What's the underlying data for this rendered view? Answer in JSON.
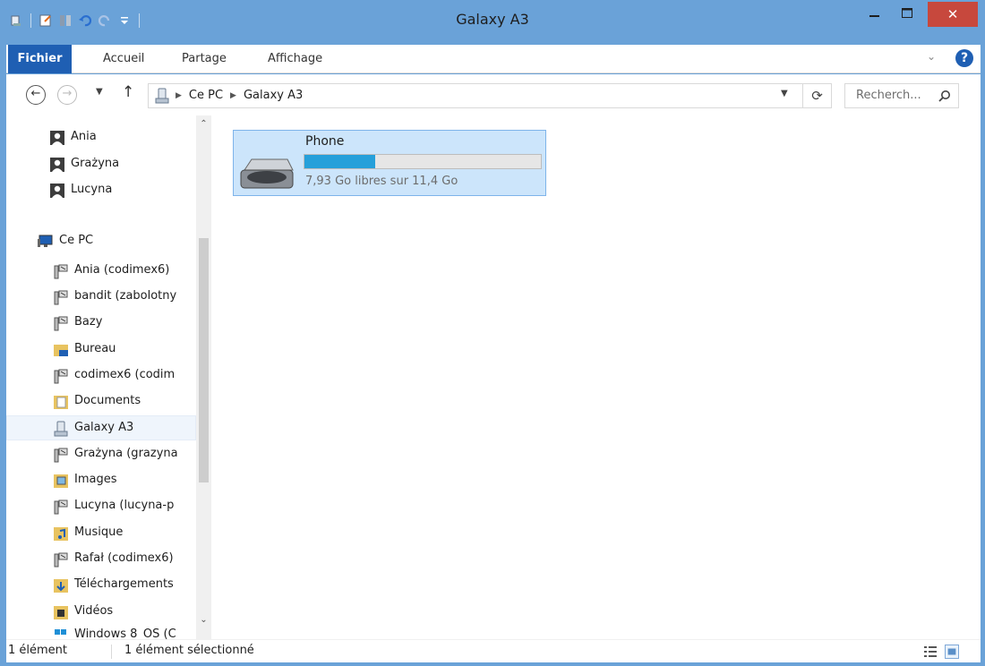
{
  "window": {
    "title": "Galaxy A3",
    "close_glyph": "✕"
  },
  "ribbon": {
    "tabs": {
      "file": "Fichier",
      "home": "Accueil",
      "share": "Partage",
      "view": "Affichage"
    },
    "help_glyph": "?"
  },
  "address": {
    "crumbs": [
      "Ce PC",
      "Galaxy A3"
    ],
    "search_placeholder": "Recherch..."
  },
  "nav": {
    "items": [
      {
        "label": "Ania",
        "icon": "user-folder-icon"
      },
      {
        "label": "Grażyna",
        "icon": "user-folder-icon"
      },
      {
        "label": "Lucyna",
        "icon": "user-folder-icon"
      },
      {
        "label": "Ce PC",
        "icon": "computer-icon"
      },
      {
        "label": "Ania (codimex6)",
        "icon": "network-drive-icon"
      },
      {
        "label": "bandit (zabolotny",
        "icon": "network-drive-icon"
      },
      {
        "label": "Bazy",
        "icon": "network-drive-icon"
      },
      {
        "label": "Bureau",
        "icon": "desktop-folder-icon"
      },
      {
        "label": "codimex6 (codim",
        "icon": "network-drive-icon"
      },
      {
        "label": "Documents",
        "icon": "documents-folder-icon"
      },
      {
        "label": "Galaxy A3",
        "icon": "phone-device-icon"
      },
      {
        "label": "Grażyna (grazyna",
        "icon": "network-drive-icon"
      },
      {
        "label": "Images",
        "icon": "pictures-folder-icon"
      },
      {
        "label": "Lucyna (lucyna-p",
        "icon": "network-drive-icon"
      },
      {
        "label": "Musique",
        "icon": "music-folder-icon"
      },
      {
        "label": "Rafał (codimex6)",
        "icon": "network-drive-icon"
      },
      {
        "label": "Téléchargements",
        "icon": "downloads-folder-icon"
      },
      {
        "label": "Vidéos",
        "icon": "videos-folder-icon"
      },
      {
        "label": "Windows 8_OS (C",
        "icon": "windows-drive-icon"
      }
    ]
  },
  "device": {
    "name": "Phone",
    "free_text": "7,93 Go libres sur 11,4 Go",
    "used_fraction": 0.3
  },
  "status": {
    "count": "1 élément",
    "selected": "1 élément sélectionné"
  },
  "colors": {
    "accent": "#1f5fb3",
    "titlebar": "#6aa2d8",
    "selection": "#cce5fb",
    "bar_fill": "#26a0da",
    "close": "#c7483d"
  }
}
